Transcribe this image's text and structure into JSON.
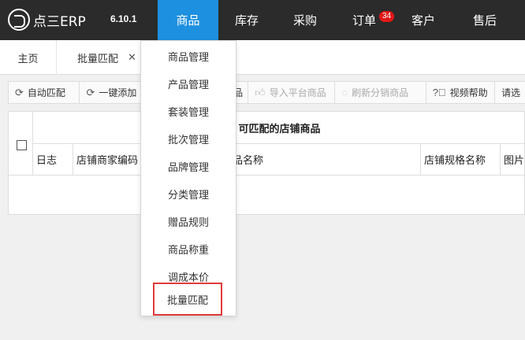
{
  "app": {
    "logo_text": "点三ERP",
    "version": "6.10.1"
  },
  "nav": [
    {
      "label": "商品",
      "active": true
    },
    {
      "label": "库存"
    },
    {
      "label": "采购"
    },
    {
      "label": "订单",
      "badge": "34"
    },
    {
      "label": "客户"
    },
    {
      "label": "售后"
    }
  ],
  "tabs": {
    "home": "主页",
    "current": "批量匹配",
    "close": "✕"
  },
  "toolbar": {
    "auto_match": "自动匹配",
    "one_click_add": "一键添加",
    "hidden_partial": "品",
    "import_platform": "导入平台商品",
    "refresh_distribution": "刷新分销商品",
    "video_help": "视频帮助",
    "truncated": "请选"
  },
  "grid": {
    "title": "可匹配的店铺商品",
    "columns": [
      "日志",
      "店铺商家编码",
      "品名称",
      "店铺规格名称",
      "图片"
    ]
  },
  "menu": {
    "items": [
      "商品管理",
      "产品管理",
      "套装管理",
      "批次管理",
      "品牌管理",
      "分类管理",
      "赠品规则",
      "商品称重",
      "调成本价",
      "批量匹配"
    ]
  },
  "colors": {
    "nav_bg": "#2b2b2b",
    "accent": "#1e90e0",
    "badge": "#e01818",
    "highlight": "#e03a3a"
  }
}
